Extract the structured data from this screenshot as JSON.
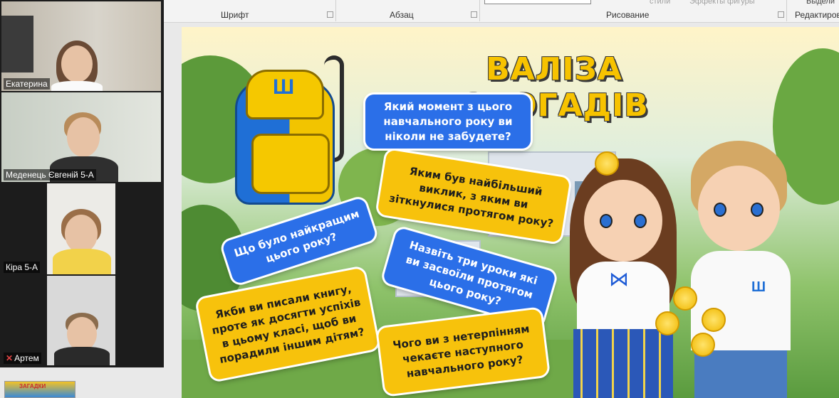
{
  "ribbon": {
    "groups": [
      "Шрифт",
      "Абзац",
      "Рисование",
      "Редактирова"
    ],
    "faded": [
      "стили",
      "Эффекты фигуры"
    ],
    "right_cut": "Выдели"
  },
  "participants": [
    {
      "name": "Екатерина",
      "muted": false
    },
    {
      "name": "Меденець Євгеній 5-А",
      "muted": false
    },
    {
      "name": "Кіра 5-А",
      "muted": false
    },
    {
      "name": "Артем",
      "muted": true
    }
  ],
  "thumbnail": {
    "label": "ЗАГАДКИ"
  },
  "slide": {
    "title": "ВАЛІЗА СПОГАДІВ",
    "questions": [
      "Який момент з цього навчального року ви ніколи не забудете?",
      "Яким був найбільший виклик, з яким ви зіткнулися протягом року?",
      "Що було найкращим цього року?",
      "Назвіть три уроки які ви засвоїли протягом цього року?",
      "Якби ви писали книгу, проте як досягти успіхів в цьому класі, щоб ви порадили іншим дітям?",
      "Чого ви з нетерпінням чекаєте наступного навчального року?"
    ]
  },
  "colors": {
    "blue_card": "#2b6fe8",
    "yellow_card": "#f7c20c",
    "title": "#f7c300"
  }
}
